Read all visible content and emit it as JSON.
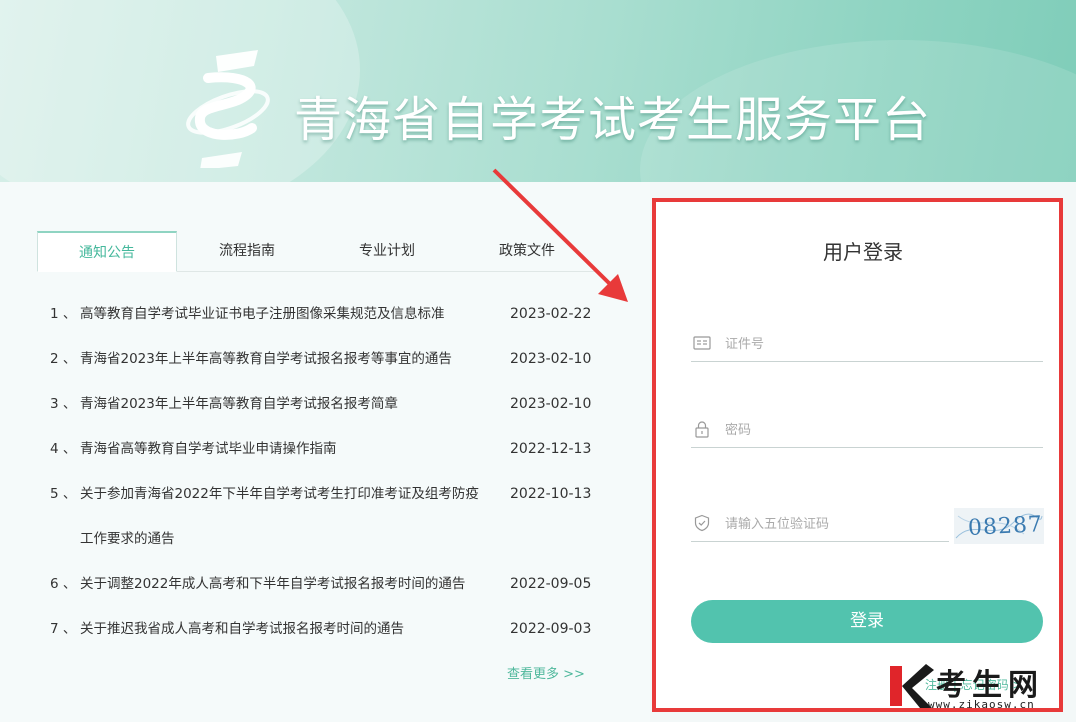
{
  "header": {
    "site_title": "青海省自学考试考生服务平台",
    "logo_icon": "platform-logo-icon"
  },
  "tabs": [
    {
      "label": "通知公告",
      "active": true
    },
    {
      "label": "流程指南",
      "active": false
    },
    {
      "label": "专业计划",
      "active": false
    },
    {
      "label": "政策文件",
      "active": false
    }
  ],
  "news": [
    {
      "num": "1 、",
      "title": "高等教育自学考试毕业证书电子注册图像采集规范及信息标准",
      "date": "2023-02-22"
    },
    {
      "num": "2 、",
      "title": "青海省2023年上半年高等教育自学考试报名报考等事宜的通告",
      "date": "2023-02-10"
    },
    {
      "num": "3 、",
      "title": "青海省2023年上半年高等教育自学考试报名报考简章",
      "date": "2023-02-10"
    },
    {
      "num": "4 、",
      "title": "青海省高等教育自学考试毕业申请操作指南",
      "date": "2022-12-13"
    },
    {
      "num": "5 、",
      "title": "关于参加青海省2022年下半年自学考试考生打印准考证及组考防疫工作要求的通告",
      "date": "2022-10-13"
    },
    {
      "num": "6 、",
      "title": "关于调整2022年成人高考和下半年自学考试报名报考时间的通告",
      "date": "2022-09-05"
    },
    {
      "num": "7 、",
      "title": "关于推迟我省成人高考和自学考试报名报考时间的通告",
      "date": "2022-09-03"
    }
  ],
  "more_label": "查看更多 >>",
  "login": {
    "title": "用户登录",
    "id_placeholder": "证件号",
    "password_placeholder": "密码",
    "captcha_placeholder": "请输入五位验证码",
    "captcha_text": "08287",
    "submit_label": "登录",
    "bottom_links": "注册 | 忘记密码 >"
  },
  "watermark": {
    "text": "考生网",
    "sub": "www.zikaosw.cn"
  },
  "colors": {
    "accent": "#52c3ae",
    "highlight_frame": "#e83a3a"
  }
}
